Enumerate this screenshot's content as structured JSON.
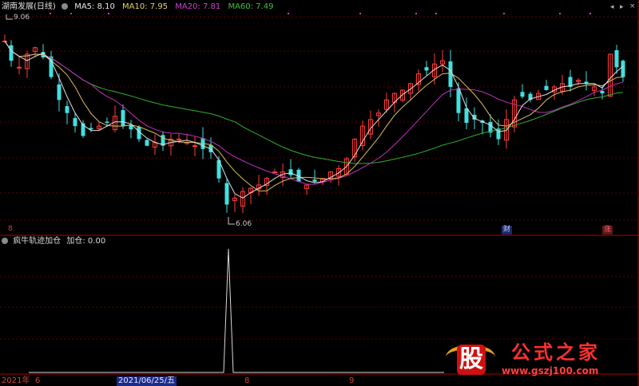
{
  "header": {
    "stock_name": "湖南发展(日线)",
    "indicators": [
      {
        "name": "MA5",
        "label": "MA5: 8.10",
        "color": "#e8e8e8"
      },
      {
        "name": "MA10",
        "label": "MA10: 7.95",
        "color": "#e8d06a"
      },
      {
        "name": "MA20",
        "label": "MA20: 7.81",
        "color": "#d040d0"
      },
      {
        "name": "MA60",
        "label": "MA60: 7.49",
        "color": "#40c040"
      }
    ],
    "controls": {
      "left_arrow": "◂",
      "right_arrow": "▸",
      "close": "×"
    }
  },
  "price_panel": {
    "high_label": "9.06",
    "low_label": "6.06",
    "markers": [
      {
        "text": "8",
        "color": "#ff3030"
      },
      {
        "text": "财",
        "color": "#c8c8ff",
        "bg": "#1a2a6a"
      },
      {
        "text": "涨",
        "color": "#ff6060",
        "bg": "#5a1a1a"
      }
    ]
  },
  "sub_panel": {
    "title": "疯牛轨迹加仓",
    "value_label": "加仓: 0.00",
    "colors": {
      "line": "#d8d8d8"
    }
  },
  "x_axis": {
    "year_label": "2021年",
    "labels": [
      "6",
      "8",
      "9"
    ],
    "cursor_date": "2021/06/25/五"
  },
  "watermark": {
    "logo_char": "股",
    "site_name": "公式之家",
    "url": "www.gszj100.com"
  },
  "colors": {
    "up": "#ff3c3c",
    "down": "#40e0e0",
    "grid": "#5a0000",
    "panel_border": "#b00000"
  }
}
